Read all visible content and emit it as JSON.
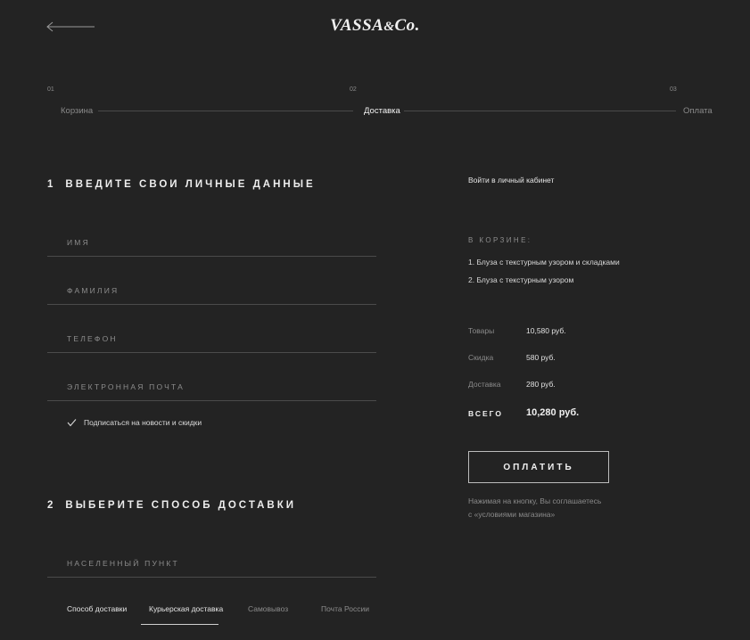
{
  "header": {
    "logo_main": "VASSA",
    "logo_amp": "&",
    "logo_tail": "Co."
  },
  "steps": [
    {
      "num": "01",
      "label": "Корзина",
      "active": false
    },
    {
      "num": "02",
      "label": "Доставка",
      "active": true
    },
    {
      "num": "03",
      "label": "Оплата",
      "active": false
    }
  ],
  "personal": {
    "num": "1",
    "title": "ВВЕДИТЕ СВОИ ЛИЧНЫЕ ДАННЫЕ",
    "fields": {
      "first_name": "Имя",
      "last_name": "Фамилия",
      "phone": "Телефон",
      "email": "Электронная почта"
    },
    "subscribe_label": "Подписаться на новости и скидки",
    "subscribe_checked": true
  },
  "delivery": {
    "num": "2",
    "title": "ВЫБЕРИТЕ СПОСОБ ДОСТАВКИ",
    "city_label": "Населенный пункт",
    "method_label": "Способ доставки",
    "options": [
      "Курьерская доставка",
      "Самовывоз",
      "Почта России"
    ],
    "selected": "Курьерская доставка"
  },
  "summary": {
    "login_link": "Войти в личный кабинет",
    "cart_title": "В КОРЗИНЕ:",
    "items": [
      "1. Блуза с текстурным узором и складками",
      "2. Блуза с текстурным узором"
    ],
    "rows": [
      {
        "label": "Товары",
        "value": "10,580 руб."
      },
      {
        "label": "Скидка",
        "value": "580 руб."
      },
      {
        "label": "Доставка",
        "value": "280 руб."
      }
    ],
    "total_label": "ВСЕГО",
    "total_value": "10,280 руб.",
    "pay_button": "ОПЛАТИТЬ",
    "disclaimer_line1": "Нажимая на кнопку, Вы соглашаетесь",
    "disclaimer_line2": "с «условиями магазина»"
  },
  "colors": {
    "background": "#232323",
    "text": "#d8d8d8",
    "muted": "#8c8c8c",
    "divider": "#4b4b4b"
  },
  "icons": {
    "back": "arrow-left-icon",
    "subscribe": "checkmark-icon"
  }
}
